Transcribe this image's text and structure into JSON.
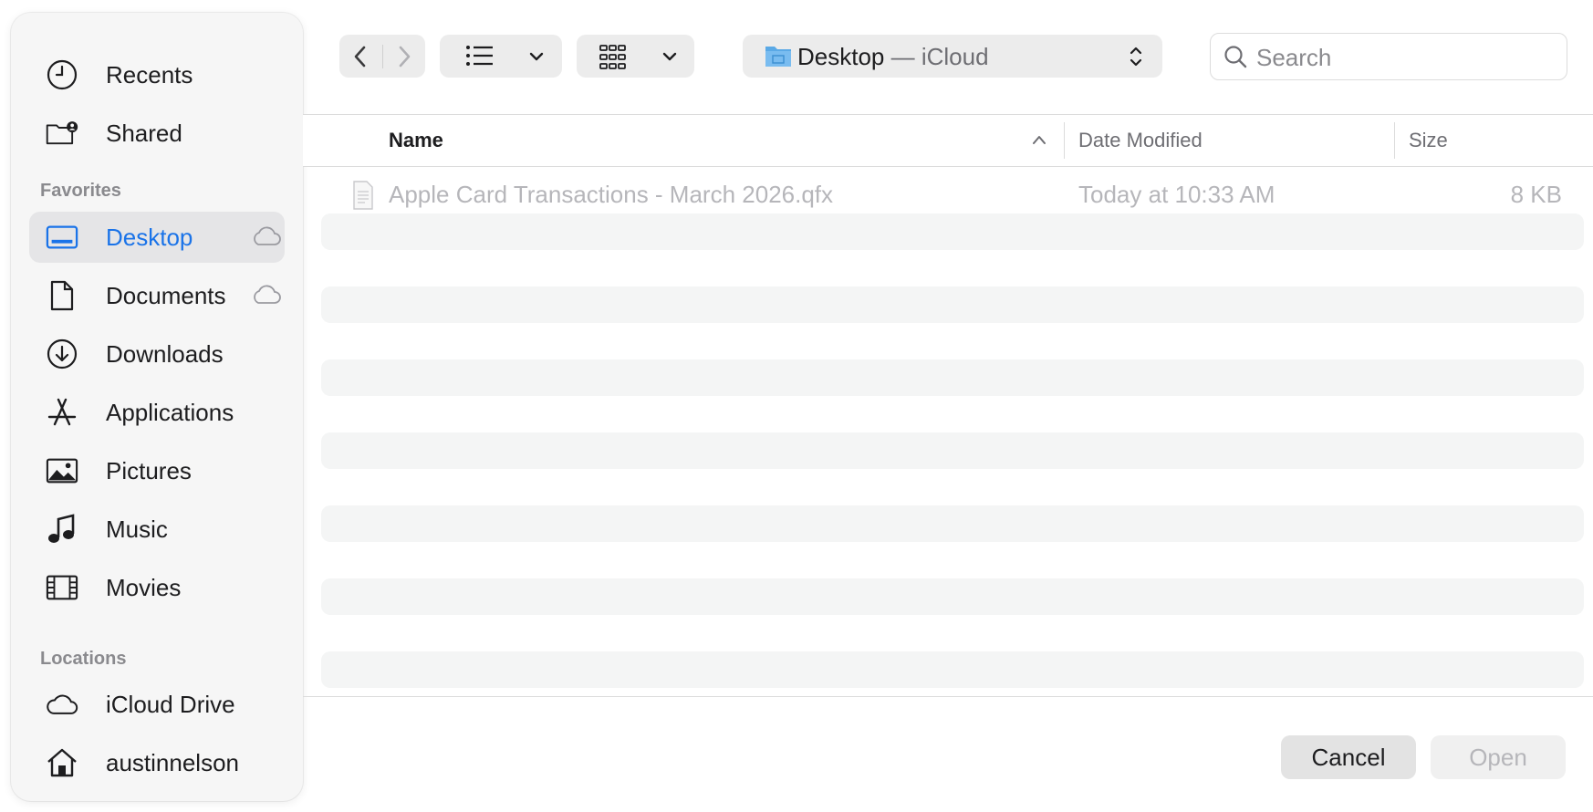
{
  "sidebar": {
    "recents": "Recents",
    "shared": "Shared",
    "favorites_heading": "Favorites",
    "favorites": [
      {
        "label": "Desktop",
        "icon": "desktop-icon",
        "cloud": true,
        "selected": true
      },
      {
        "label": "Documents",
        "icon": "document-icon",
        "cloud": true
      },
      {
        "label": "Downloads",
        "icon": "download-icon"
      },
      {
        "label": "Applications",
        "icon": "applications-icon"
      },
      {
        "label": "Pictures",
        "icon": "photo-icon"
      },
      {
        "label": "Music",
        "icon": "music-note-icon"
      },
      {
        "label": "Movies",
        "icon": "film-icon"
      }
    ],
    "locations_heading": "Locations",
    "locations": [
      {
        "label": "iCloud Drive",
        "icon": "cloud-icon"
      },
      {
        "label": "austinnelson",
        "icon": "home-icon"
      }
    ]
  },
  "toolbar": {
    "path_folder": "Desktop",
    "path_separator": " — ",
    "path_location": "iCloud",
    "search_placeholder": "Search"
  },
  "columns": {
    "name": "Name",
    "date_modified": "Date Modified",
    "size": "Size"
  },
  "files": [
    {
      "name": "Apple Card Transactions - March 2026.qfx",
      "date_modified": "Today at 10:33 AM",
      "size": "8 KB"
    }
  ],
  "buttons": {
    "cancel": "Cancel",
    "open": "Open"
  },
  "colors": {
    "accent": "#1a73e8",
    "disabled_text": "#b6b6ba",
    "sidebar_bg": "#f6f6f6"
  }
}
